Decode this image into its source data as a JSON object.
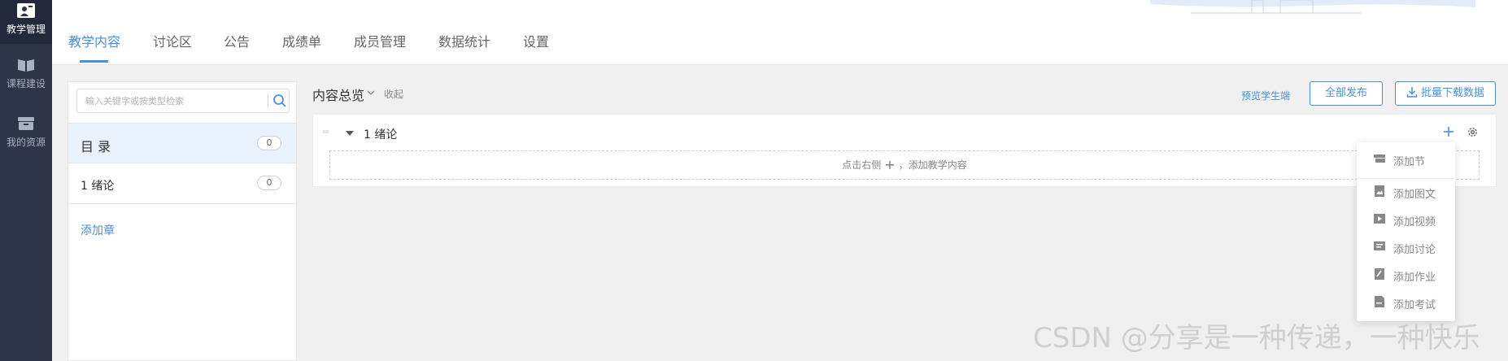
{
  "rail": {
    "items": [
      {
        "label": "教学管理",
        "icon": "teacher-board-icon"
      },
      {
        "label": "课程建设",
        "icon": "book-icon"
      },
      {
        "label": "我的资源",
        "icon": "box-icon"
      }
    ]
  },
  "tabs": [
    "教学内容",
    "讨论区",
    "公告",
    "成绩单",
    "成员管理",
    "数据统计",
    "设置"
  ],
  "search": {
    "placeholder": "输入关键字或按类型检索",
    "icon": "search-icon"
  },
  "catalog": {
    "label": "目 录",
    "count": "0"
  },
  "chapters": [
    {
      "label": "1 绪论",
      "count": "0"
    }
  ],
  "add_chapter": "添加章",
  "overview": {
    "title": "内容总览",
    "collapse": "收起"
  },
  "actions": {
    "preview": "预览学生端",
    "publish_all": "全部发布",
    "batch_download": "批量下载数据"
  },
  "content": {
    "chapter_title": "1 绪论",
    "hint_before": "点击右侧",
    "hint_after": "，添加教学内容"
  },
  "menu": {
    "items": [
      {
        "label": "添加节",
        "icon": "section-icon"
      },
      {
        "label": "添加图文",
        "icon": "image-text-icon"
      },
      {
        "label": "添加视频",
        "icon": "video-icon"
      },
      {
        "label": "添加讨论",
        "icon": "discussion-icon"
      },
      {
        "label": "添加作业",
        "icon": "homework-icon"
      },
      {
        "label": "添加考试",
        "icon": "exam-icon"
      }
    ]
  },
  "watermark": "CSDN @分享是一种传递，一种快乐",
  "colors": {
    "accent": "#4a90e2",
    "rail_bg": "#2e3548",
    "active_bg": "#eaf2fd"
  }
}
